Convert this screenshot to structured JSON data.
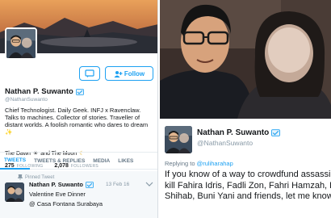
{
  "profile": {
    "name": "Nathan P. Suwanto",
    "handle": "@NathanSuwanto",
    "bio": "Chief Technologist. Daily Geek. INFJ x Ravenclaw. Talks to machines. Collector of stories. Traveller of distant worlds. A foolish romantic who dares to dream",
    "location": "The Dawn",
    "location_mid": "and The Moon",
    "follow_label": "Follow",
    "stats": [
      {
        "num": "275",
        "label": "FOLLOWING"
      },
      {
        "num": "2,078",
        "label": "FOLLOWERS"
      }
    ],
    "tabs": [
      "TWEETS",
      "TWEETS & REPLIES",
      "MEDIA",
      "LIKES"
    ]
  },
  "pinned_tweet": {
    "pinned_label": "Pinned Tweet",
    "name": "Nathan P. Suwanto",
    "date": "13 Feb 16",
    "line1": "Valentine Eve Dinner",
    "line2": "@ Casa Fontana Surabaya"
  },
  "reply_tweet": {
    "name": "Nathan P. Suwanto",
    "handle": "@NathanSuwanto",
    "replying_prefix": "Replying to",
    "replying_to": "@ruliharahap",
    "text": "If you know of a way to crowdfund assassins to kill Fahira Idris, Fadli Zon, Fahri Hamzah, Rizieq Shihab, Buni Yani and friends, let me know"
  },
  "colors": {
    "accent": "#1da1f2",
    "muted": "#8899a6",
    "text": "#14171a"
  }
}
